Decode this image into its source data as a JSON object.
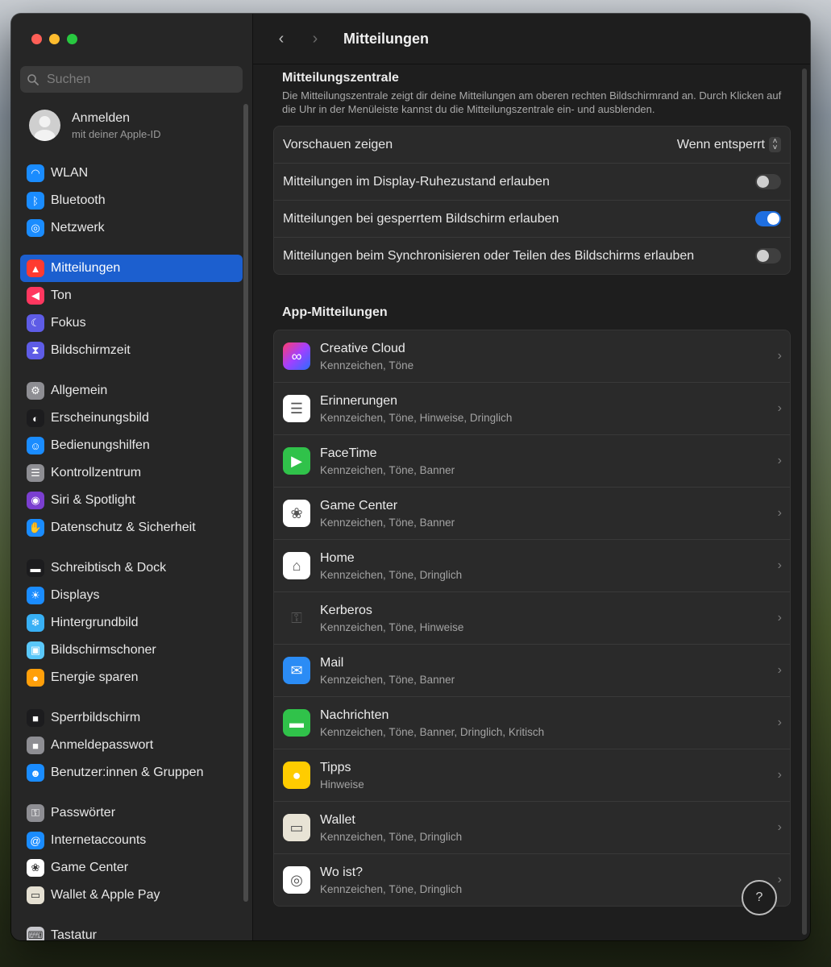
{
  "sidebar": {
    "search_placeholder": "Suchen",
    "account": {
      "name": "Anmelden",
      "subtitle": "mit deiner Apple-ID"
    },
    "groups": [
      [
        {
          "label": "WLAN",
          "icon": "wifi-icon",
          "color": "#1a8cff",
          "glyph": "◠"
        },
        {
          "label": "Bluetooth",
          "icon": "bluetooth-icon",
          "color": "#1a8cff",
          "glyph": "ᛒ"
        },
        {
          "label": "Netzwerk",
          "icon": "globe-icon",
          "color": "#1a8cff",
          "glyph": "◎"
        }
      ],
      [
        {
          "label": "Mitteilungen",
          "icon": "bell-icon",
          "color": "#ff3b30",
          "glyph": "▲",
          "active": true
        },
        {
          "label": "Ton",
          "icon": "speaker-icon",
          "color": "#ff375f",
          "glyph": "◀"
        },
        {
          "label": "Fokus",
          "icon": "moon-icon",
          "color": "#5e5ce6",
          "glyph": "☾"
        },
        {
          "label": "Bildschirmzeit",
          "icon": "hourglass-icon",
          "color": "#5e5ce6",
          "glyph": "⧗"
        }
      ],
      [
        {
          "label": "Allgemein",
          "icon": "gear-icon",
          "color": "#8e8e93",
          "glyph": "⚙"
        },
        {
          "label": "Erscheinungsbild",
          "icon": "appearance-icon",
          "color": "#1c1c1e",
          "glyph": "◐"
        },
        {
          "label": "Bedienungshilfen",
          "icon": "accessibility-icon",
          "color": "#1a8cff",
          "glyph": "☺"
        },
        {
          "label": "Kontrollzentrum",
          "icon": "control-center-icon",
          "color": "#8e8e93",
          "glyph": "☰"
        },
        {
          "label": "Siri & Spotlight",
          "icon": "siri-icon",
          "color": "#7b3fd0",
          "glyph": "◉"
        },
        {
          "label": "Datenschutz & Sicherheit",
          "icon": "hand-icon",
          "color": "#1a8cff",
          "glyph": "✋"
        }
      ],
      [
        {
          "label": "Schreibtisch & Dock",
          "icon": "dock-icon",
          "color": "#1c1c1e",
          "glyph": "▬"
        },
        {
          "label": "Displays",
          "icon": "sun-icon",
          "color": "#1a8cff",
          "glyph": "☀"
        },
        {
          "label": "Hintergrundbild",
          "icon": "wallpaper-icon",
          "color": "#38b0f5",
          "glyph": "❄"
        },
        {
          "label": "Bildschirmschoner",
          "icon": "screensaver-icon",
          "color": "#5ac8fa",
          "glyph": "▣"
        },
        {
          "label": "Energie sparen",
          "icon": "bulb-icon",
          "color": "#ff9f0a",
          "glyph": "●"
        }
      ],
      [
        {
          "label": "Sperrbildschirm",
          "icon": "lock-screen-icon",
          "color": "#1c1c1e",
          "glyph": "■"
        },
        {
          "label": "Anmeldepasswort",
          "icon": "lock-icon",
          "color": "#8e8e93",
          "glyph": "■"
        },
        {
          "label": "Benutzer:innen & Gruppen",
          "icon": "users-icon",
          "color": "#1a8cff",
          "glyph": "☻"
        }
      ],
      [
        {
          "label": "Passwörter",
          "icon": "key-icon",
          "color": "#8e8e93",
          "glyph": "⚿"
        },
        {
          "label": "Internetaccounts",
          "icon": "at-icon",
          "color": "#1a8cff",
          "glyph": "@"
        },
        {
          "label": "Game Center",
          "icon": "game-center-icon",
          "color": "#ffffff",
          "glyph": "❀"
        },
        {
          "label": "Wallet & Apple Pay",
          "icon": "wallet-icon",
          "color": "#e5e0d2",
          "glyph": "▭"
        }
      ],
      [
        {
          "label": "Tastatur",
          "icon": "keyboard-icon",
          "color": "#c7c7cc",
          "glyph": "⌨"
        }
      ]
    ]
  },
  "toolbar": {
    "title": "Mitteilungen",
    "back": "‹",
    "forward": "›"
  },
  "main": {
    "section_title": "Mitteilungszentrale",
    "section_desc": "Die Mitteilungszentrale zeigt dir deine Mitteilungen am oberen rechten Bildschirmrand an. Durch Klicken auf die Uhr in der Menüleiste kannst du die Mitteilungszentrale ein- und ausblenden.",
    "settings": [
      {
        "label": "Vorschauen zeigen",
        "type": "select",
        "value": "Wenn entsperrt"
      },
      {
        "label": "Mitteilungen im Display-Ruhezustand erlauben",
        "type": "toggle",
        "on": false
      },
      {
        "label": "Mitteilungen bei gesperrtem Bildschirm erlauben",
        "type": "toggle",
        "on": true
      },
      {
        "label": "Mitteilungen beim Synchronisieren oder Teilen des Bildschirms erlauben",
        "type": "toggle",
        "on": false
      }
    ],
    "apps_title": "App-Mitteilungen",
    "apps": [
      {
        "name": "Creative Cloud",
        "sub": "Kennzeichen, Töne",
        "icon": "creative-cloud-icon",
        "bg": "linear-gradient(135deg,#ff3c6e,#a140ff,#2a6dff)",
        "glyph": "∞"
      },
      {
        "name": "Erinnerungen",
        "sub": "Kennzeichen, Töne, Hinweise, Dringlich",
        "icon": "reminders-icon",
        "bg": "#ffffff",
        "glyph": "☰"
      },
      {
        "name": "FaceTime",
        "sub": "Kennzeichen, Töne, Banner",
        "icon": "facetime-icon",
        "bg": "#30c24a",
        "glyph": "▶"
      },
      {
        "name": "Game Center",
        "sub": "Kennzeichen, Töne, Banner",
        "icon": "game-center-icon",
        "bg": "#ffffff",
        "glyph": "❀"
      },
      {
        "name": "Home",
        "sub": "Kennzeichen, Töne, Dringlich",
        "icon": "home-icon",
        "bg": "#ffffff",
        "glyph": "⌂"
      },
      {
        "name": "Kerberos",
        "sub": "Kennzeichen, Töne, Hinweise",
        "icon": "kerberos-icon",
        "bg": "transparent",
        "glyph": "⚿"
      },
      {
        "name": "Mail",
        "sub": "Kennzeichen, Töne, Banner",
        "icon": "mail-icon",
        "bg": "#2b8cf5",
        "glyph": "✉"
      },
      {
        "name": "Nachrichten",
        "sub": "Kennzeichen, Töne, Banner, Dringlich, Kritisch",
        "icon": "messages-icon",
        "bg": "#30c24a",
        "glyph": "▬"
      },
      {
        "name": "Tipps",
        "sub": "Hinweise",
        "icon": "tips-icon",
        "bg": "#ffcc00",
        "glyph": "●"
      },
      {
        "name": "Wallet",
        "sub": "Kennzeichen, Töne, Dringlich",
        "icon": "wallet-icon",
        "bg": "#e8e3d5",
        "glyph": "▭"
      },
      {
        "name": "Wo ist?",
        "sub": "Kennzeichen, Töne, Dringlich",
        "icon": "find-my-icon",
        "bg": "#ffffff",
        "glyph": "◎"
      }
    ],
    "help_glyph": "?"
  }
}
